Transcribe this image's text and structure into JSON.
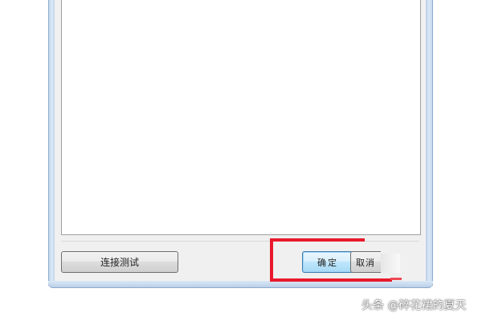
{
  "dialog": {
    "buttons": {
      "test_connection": "连接测试",
      "ok": "确定",
      "cancel": "取消"
    }
  },
  "watermark": {
    "text": "头条 @碎花裙的夏天"
  },
  "colors": {
    "annotation": "#e8192c",
    "frame": "#c4d8ee",
    "dialog_bg": "#f0f0f0",
    "ok_button": "#bee6fd"
  }
}
